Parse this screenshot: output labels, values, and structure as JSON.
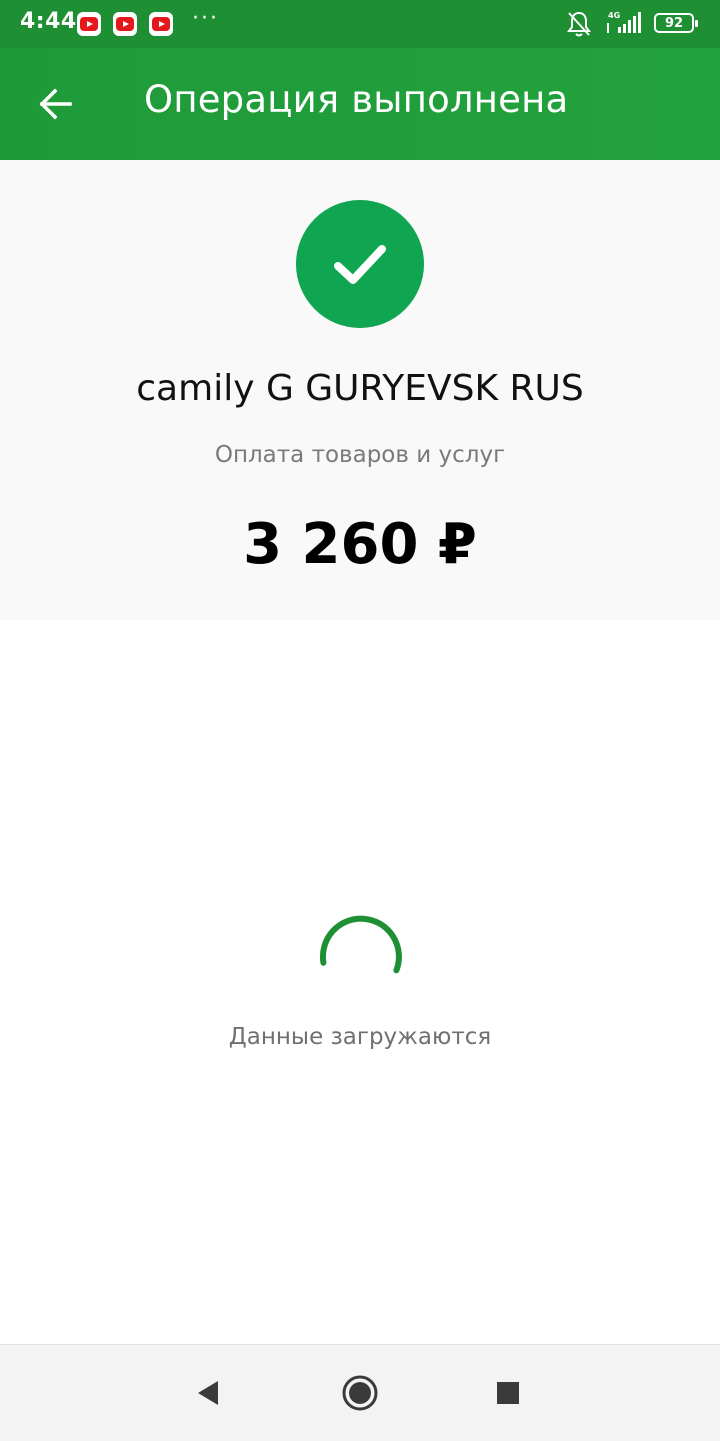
{
  "status_bar": {
    "time": "4:44",
    "notification_icons": [
      "youtube-icon",
      "youtube-icon",
      "youtube-icon"
    ],
    "more": "···",
    "network": "4G",
    "battery": "92",
    "colors": {
      "background": "#1e8f33"
    }
  },
  "app_bar": {
    "title": "Операция выполнена",
    "back_icon": "arrow-left-icon",
    "colors": {
      "background": "#22a23d"
    }
  },
  "summary": {
    "status_icon": "check-icon",
    "merchant": "camily G GURYEVSK RUS",
    "operation_type": "Оплата товаров и услуг",
    "amount": "3 260 ₽",
    "colors": {
      "check": "#10a551",
      "background": "#f9f9f9"
    }
  },
  "loader": {
    "text": "Данные загружаются",
    "colors": {
      "spinner": "#1e8f33"
    }
  },
  "nav_bar": {
    "buttons": [
      "back-triangle-icon",
      "home-circle-icon",
      "recents-square-icon"
    ]
  }
}
